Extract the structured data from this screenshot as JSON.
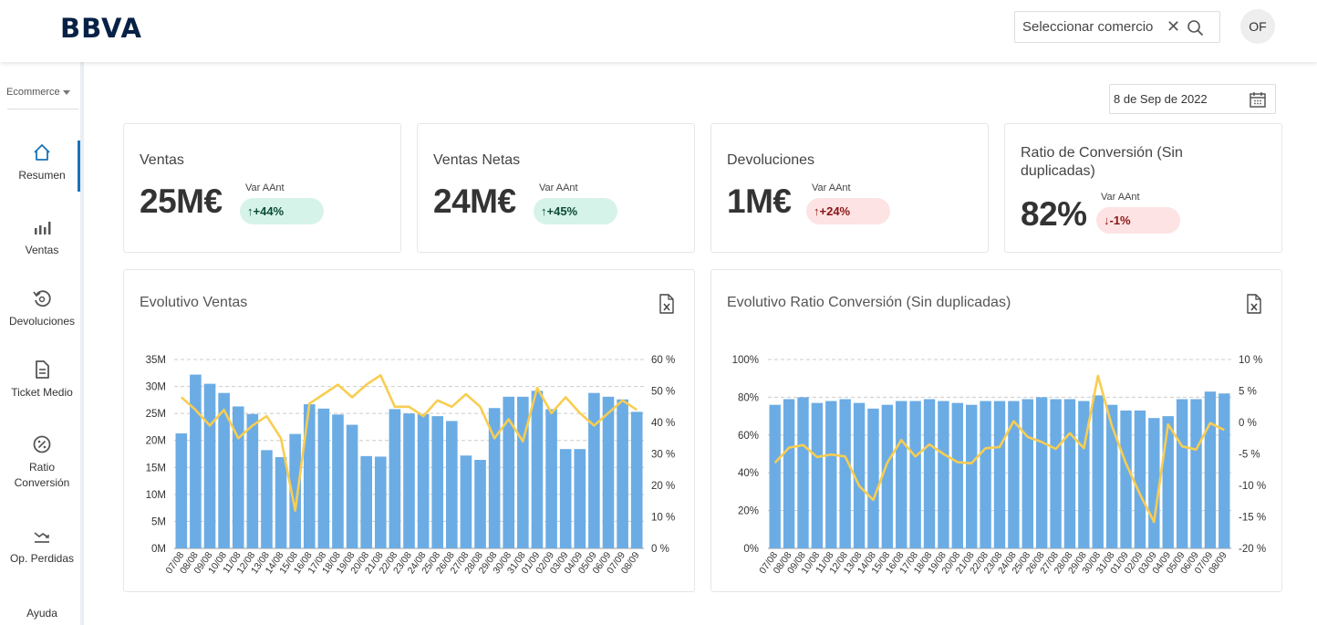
{
  "header": {
    "logo": "BBVA",
    "search_placeholder": "Seleccionar comercio",
    "clear_symbol": "✕",
    "avatar_initials": "OF"
  },
  "sidebar": {
    "selector": "Ecommerce",
    "items": [
      {
        "label": "Resumen",
        "icon": "home-icon",
        "active": true
      },
      {
        "label": "Ventas",
        "icon": "bar-chart-icon"
      },
      {
        "label": "Devoluciones",
        "icon": "return-icon"
      },
      {
        "label": "Ticket Medio",
        "icon": "receipt-icon"
      },
      {
        "label": "Ratio Conversión",
        "icon": "percent-badge-icon"
      },
      {
        "label": "Op. Perdidas",
        "icon": "trend-down-icon"
      },
      {
        "label": "Ayuda",
        "icon": ""
      }
    ]
  },
  "date_picker": {
    "value": "8 de Sep de 2022",
    "icon": "calendar-icon"
  },
  "kpis": [
    {
      "title": "Ventas",
      "value": "25M€",
      "var_label": "Var AAnt",
      "var_value": "↑+44%",
      "trend": "positive"
    },
    {
      "title": "Ventas Netas",
      "value": "24M€",
      "var_label": "Var AAnt",
      "var_value": "↑+45%",
      "trend": "positive"
    },
    {
      "title": "Devoluciones",
      "value": "1M€",
      "var_label": "Var AAnt",
      "var_value": "↑+24%",
      "trend": "negative"
    },
    {
      "title": "Ratio de Conversión (Sin duplicadas)",
      "value": "82%",
      "var_label": "Var AAnt",
      "var_value": "↓-1%",
      "trend": "negative"
    }
  ],
  "charts_ui": [
    {
      "title": "Evolutivo Ventas",
      "export_icon": "excel-export-icon"
    },
    {
      "title": "Evolutivo Ratio Conversión (Sin duplicadas)",
      "export_icon": "excel-export-icon"
    }
  ],
  "colors": {
    "bar": "#6cace4",
    "line": "#f8cd51",
    "brand": "#072146",
    "accent": "#1973b8"
  },
  "chart_data": [
    {
      "type": "bar",
      "categories": [
        "07/08",
        "08/08",
        "09/08",
        "10/08",
        "11/08",
        "12/08",
        "13/08",
        "14/08",
        "15/08",
        "16/08",
        "17/08",
        "18/08",
        "19/08",
        "20/08",
        "21/08",
        "22/08",
        "23/08",
        "24/08",
        "25/08",
        "26/08",
        "27/08",
        "28/08",
        "29/08",
        "30/08",
        "31/08",
        "01/09",
        "02/09",
        "03/09",
        "04/09",
        "05/09",
        "06/09",
        "07/09",
        "08/09"
      ],
      "y_ticks": [
        "35M",
        "30M",
        "25M",
        "20M",
        "15M",
        "10M",
        "5M",
        "0M"
      ],
      "y2_ticks": [
        "60 %",
        "50 %",
        "40 %",
        "30 %",
        "20 %",
        "10 %",
        "0 %"
      ],
      "ylim": [
        0,
        35
      ],
      "y2lim": [
        0,
        60
      ],
      "series": [
        {
          "type": "bar",
          "axis": "left",
          "values": [
            21.3,
            32.2,
            30.5,
            28.8,
            26.3,
            24.9,
            18.2,
            16.9,
            21.2,
            26.7,
            25.9,
            24.8,
            22.9,
            17.1,
            17.0,
            25.8,
            25.0,
            24.9,
            24.5,
            23.6,
            17.2,
            16.4,
            26.0,
            28.1,
            28.1,
            29.2,
            25.8,
            18.4,
            18.4,
            28.8,
            28.1,
            27.6,
            25.3
          ]
        },
        {
          "type": "line",
          "axis": "right",
          "values": [
            48,
            44,
            39,
            44,
            35,
            39,
            42,
            35,
            12,
            46,
            49,
            52,
            48,
            52,
            55,
            45,
            45,
            42,
            47,
            45,
            49,
            45,
            35,
            41,
            34,
            51,
            43,
            48,
            43,
            39,
            43,
            47,
            44
          ]
        }
      ]
    },
    {
      "type": "bar",
      "categories": [
        "07/08",
        "08/08",
        "09/08",
        "10/08",
        "11/08",
        "12/08",
        "13/08",
        "14/08",
        "15/08",
        "16/08",
        "17/08",
        "18/08",
        "19/08",
        "20/08",
        "21/08",
        "22/08",
        "23/08",
        "24/08",
        "25/08",
        "26/08",
        "27/08",
        "28/08",
        "29/08",
        "30/08",
        "31/08",
        "01/09",
        "02/09",
        "03/09",
        "04/09",
        "05/09",
        "06/09",
        "07/09",
        "08/09"
      ],
      "y_ticks": [
        "100%",
        "80%",
        "60%",
        "40%",
        "20%",
        "0%"
      ],
      "y2_ticks": [
        "10 %",
        "5 %",
        "0 %",
        "-5 %",
        "-10 %",
        "-15 %",
        "-20 %"
      ],
      "ylim": [
        0,
        100
      ],
      "y2lim": [
        -20,
        10
      ],
      "series": [
        {
          "type": "bar",
          "axis": "left",
          "values": [
            76,
            79,
            80,
            77,
            78,
            79,
            77,
            74,
            76,
            78,
            78,
            79,
            78,
            77,
            76,
            78,
            78,
            78,
            79,
            80,
            79,
            79,
            78,
            81,
            76,
            73,
            73,
            69,
            70,
            79,
            79,
            83,
            82
          ]
        },
        {
          "type": "line",
          "axis": "right",
          "values": [
            -6.4,
            -4.0,
            -3.6,
            -5.5,
            -5.1,
            -5.4,
            -10.1,
            -12.3,
            -6.4,
            -2.8,
            -5.4,
            -3.5,
            -5.0,
            -6.3,
            -6.5,
            -4.1,
            -3.9,
            0.2,
            -2.3,
            -3.1,
            -4.2,
            -1.7,
            -4.1,
            7.4,
            -0.6,
            -6.5,
            -11.4,
            -15.8,
            -0.3,
            -3.8,
            -4.3,
            -0.1,
            -1.2
          ]
        }
      ]
    }
  ]
}
